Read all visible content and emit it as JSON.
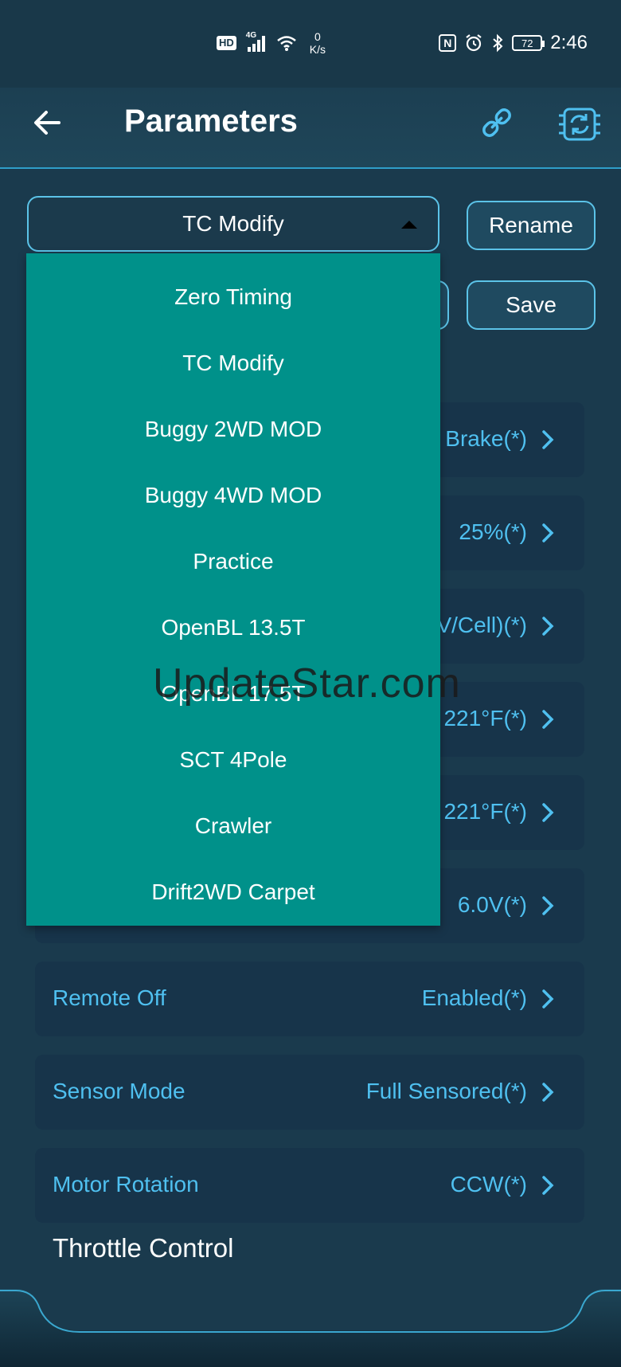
{
  "status_bar": {
    "hd": "HD",
    "network": "4G",
    "speed_value": "0",
    "speed_unit": "K/s",
    "nfc": "N",
    "battery": "72",
    "time": "2:46"
  },
  "header": {
    "title": "Parameters",
    "icons": [
      "back-arrow-icon",
      "link-icon",
      "sync-icon"
    ]
  },
  "profile": {
    "selected": "TC Modify",
    "rename_label": "Rename",
    "save_label": "Save"
  },
  "dropdown": {
    "options": [
      "Zero Timing",
      "TC Modify",
      "Buggy 2WD MOD",
      "Buggy 4WD MOD",
      "Practice",
      "OpenBL 13.5T",
      "OpenBL 17.5T",
      "SCT 4Pole",
      "Crawler",
      "Drift2WD Carpet"
    ]
  },
  "settings": [
    {
      "label": "",
      "value": "Brake(*)"
    },
    {
      "label": "",
      "value": "25%(*)"
    },
    {
      "label": "",
      "value": "V/Cell)(*)"
    },
    {
      "label": "",
      "value": "221°F(*)"
    },
    {
      "label": "",
      "value": "221°F(*)"
    },
    {
      "label": "",
      "value": "6.0V(*)"
    },
    {
      "label": "Remote Off",
      "value": "Enabled(*)"
    },
    {
      "label": "Sensor Mode",
      "value": "Full Sensored(*)"
    },
    {
      "label": "Motor Rotation",
      "value": "CCW(*)"
    }
  ],
  "section": {
    "title": "Throttle Control"
  },
  "watermark": "UpdateStar.com",
  "colors": {
    "background": "#1a3a4d",
    "accent": "#4fc0f0",
    "dropdown": "#00918a"
  }
}
